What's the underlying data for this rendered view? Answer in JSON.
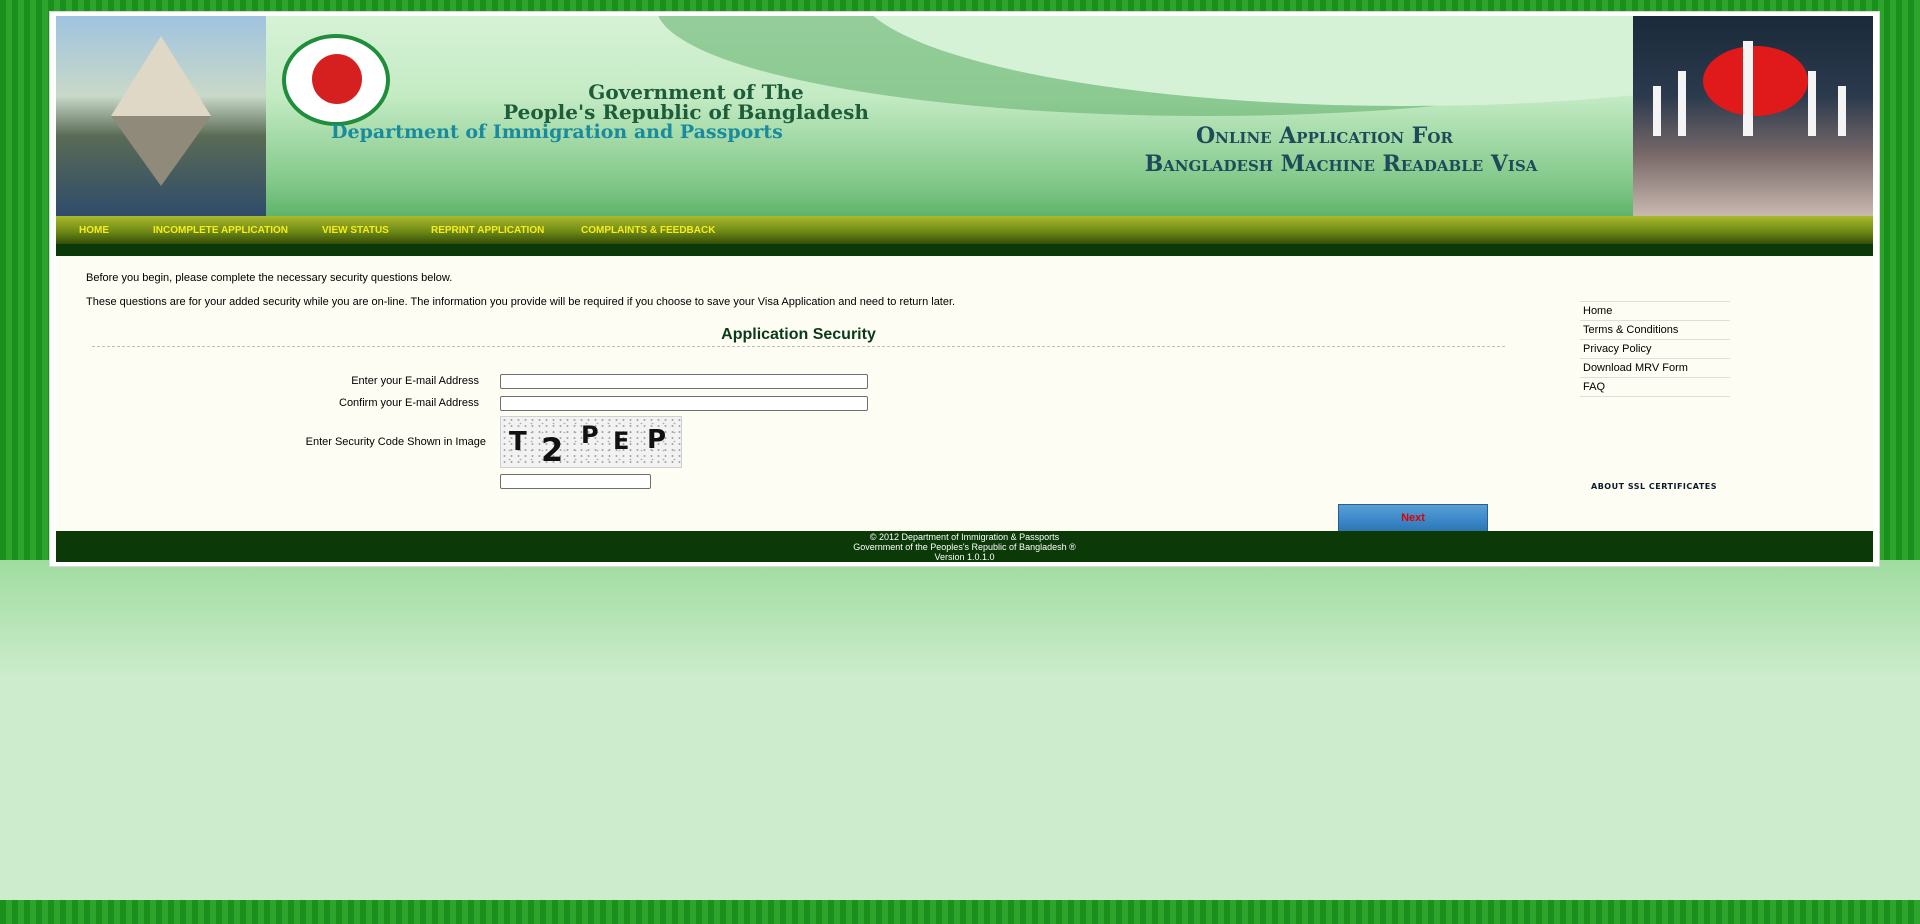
{
  "banner": {
    "gov_line1": "Government of The",
    "gov_line2": "People's Republic of Bangladesh",
    "gov_line3": "Department of Immigration and Passports",
    "app_line1": "Online  Application For",
    "app_line2": "Bangladesh Machine Readable Visa"
  },
  "nav": {
    "items": [
      {
        "label": "HOME"
      },
      {
        "label": "INCOMPLETE APPLICATION"
      },
      {
        "label": "VIEW STATUS"
      },
      {
        "label": "REPRINT APPLICATION"
      },
      {
        "label": "COMPLAINTS & FEEDBACK"
      }
    ]
  },
  "intro": {
    "line1": "Before you begin, please complete the necessary security questions below.",
    "line2": "These questions are for your added security while you are on-line. The information you provide will be required if you choose to save your Visa Application and need to return later."
  },
  "form": {
    "title": "Application Security",
    "email_label": "Enter your E-mail Address",
    "email_value": "",
    "confirm_label": "Confirm your E-mail Address",
    "confirm_value": "",
    "code_label": "Enter Security Code Shown in Image",
    "captcha_text": [
      "T",
      "2",
      "P",
      "E",
      "P"
    ],
    "code_value": "",
    "next_label": "Next"
  },
  "sidebar": {
    "links": [
      {
        "label": "Home"
      },
      {
        "label": "Terms & Conditions"
      },
      {
        "label": "Privacy Policy"
      },
      {
        "label": "Download MRV Form"
      },
      {
        "label": "FAQ"
      }
    ],
    "ssl_text": "ABOUT SSL CERTIFICATES"
  },
  "footer": {
    "line1": "© 2012 Department of Immigration & Passports",
    "line2": "Government of the Peoples's Republic of Bangladesh ®",
    "line3": "Version 1.0.1.0"
  },
  "colors": {
    "nav_text": "#f7ec1a",
    "next_text": "#e00000",
    "footer_bg": "#0b3a08"
  }
}
